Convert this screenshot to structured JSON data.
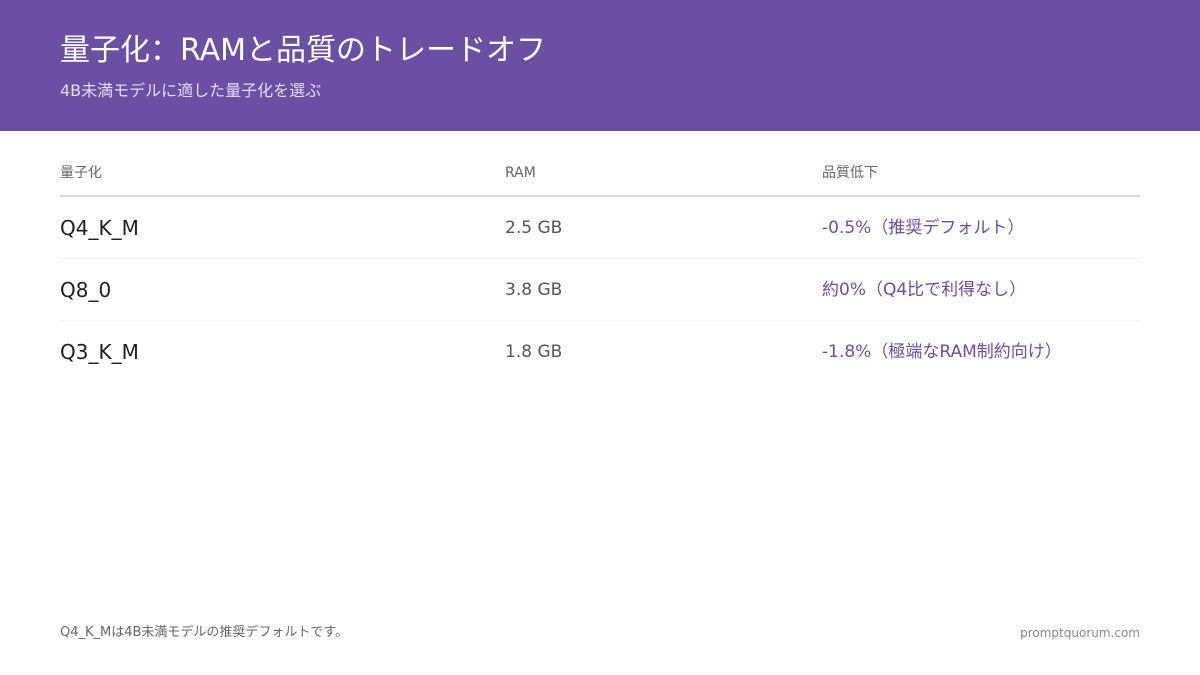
{
  "header": {
    "title": "量子化：RAMと品質のトレードオフ",
    "subtitle": "4B未満モデルに適した量子化を選ぶ"
  },
  "table": {
    "columns": [
      "量子化",
      "RAM",
      "品質低下"
    ],
    "rows": [
      {
        "quant": "Q4_K_M",
        "ram": "2.5 GB",
        "quality": "-0.5%（推奨デフォルト）"
      },
      {
        "quant": "Q8_0",
        "ram": "3.8 GB",
        "quality": "約0%（Q4比で利得なし）"
      },
      {
        "quant": "Q3_K_M",
        "ram": "1.8 GB",
        "quality": "-1.8%（極端なRAM制約向け）"
      }
    ]
  },
  "footer": {
    "note": "Q4_K_Mは4B未満モデルの推奨デフォルトです。",
    "site": "promptquorum.com"
  },
  "colors": {
    "header_bg": "#6a4fa3",
    "accent": "#6a4fa3"
  }
}
